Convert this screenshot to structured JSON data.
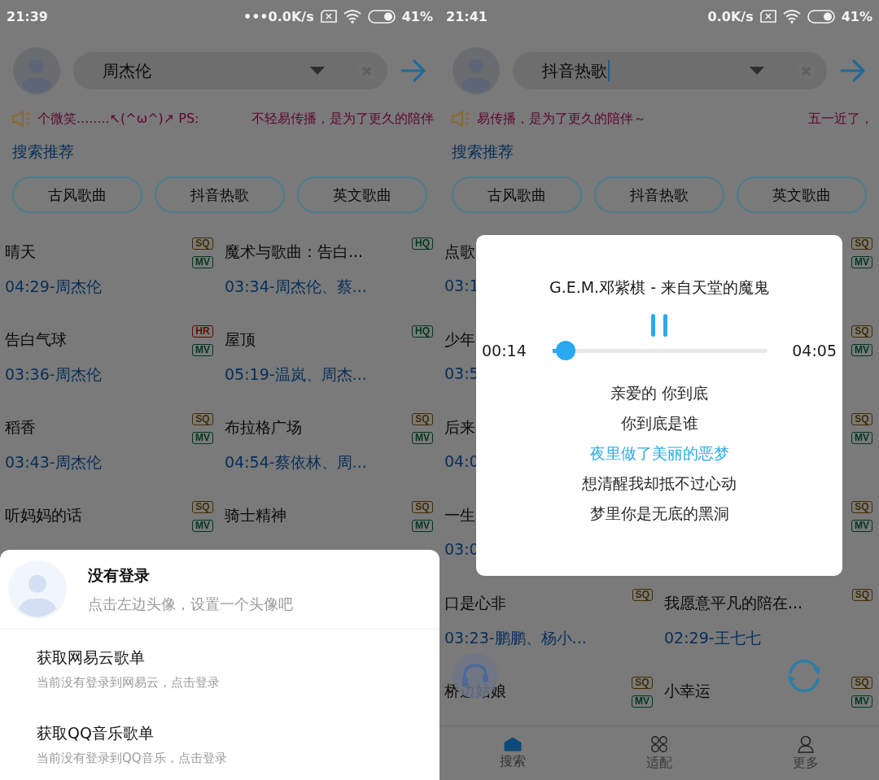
{
  "phones": [
    {
      "status": {
        "time": "21:39",
        "net_speed": "•••0.0K/s",
        "battery": "41%"
      },
      "search": {
        "value": "周杰伦",
        "caret": false
      },
      "marquee": [
        "个微笑........↖(^ω^)↗  PS:",
        "不轻易传播，是为了更久的陪伴"
      ],
      "section_title": "搜索推荐",
      "chips": [
        "古风歌曲",
        "抖音热歌",
        "英文歌曲"
      ],
      "songs": [
        {
          "title": "晴天",
          "info": "04:29-周杰伦",
          "badges": [
            {
              "label": "SQ",
              "color": "#422c00"
            },
            {
              "label": "MV",
              "color": "#00361f"
            }
          ]
        },
        {
          "title": "魔术与歌曲：告白...",
          "info": "03:34-周杰伦、蔡...",
          "badges": [
            {
              "label": "HQ",
              "color": "#00361f"
            }
          ]
        },
        {
          "title": "告白气球",
          "info": "03:36-周杰伦",
          "badges": [
            {
              "label": "HR",
              "color": "#5c0a00"
            },
            {
              "label": "MV",
              "color": "#00361f"
            }
          ]
        },
        {
          "title": "屋顶",
          "info": "05:19-温岚、周杰...",
          "badges": [
            {
              "label": "HQ",
              "color": "#00361f"
            }
          ]
        },
        {
          "title": "稻香",
          "info": "03:43-周杰伦",
          "badges": [
            {
              "label": "SQ",
              "color": "#422c00"
            },
            {
              "label": "MV",
              "color": "#00361f"
            }
          ]
        },
        {
          "title": "布拉格广场",
          "info": "04:54-蔡依林、周...",
          "badges": [
            {
              "label": "SQ",
              "color": "#422c00"
            },
            {
              "label": "MV",
              "color": "#00361f"
            }
          ]
        },
        {
          "title": "听妈妈的话",
          "badges": [
            {
              "label": "SQ",
              "color": "#422c00"
            },
            {
              "label": "MV",
              "color": "#00361f"
            }
          ]
        },
        {
          "title": "骑士精神",
          "badges": [
            {
              "label": "SQ",
              "color": "#422c00"
            },
            {
              "label": "MV",
              "color": "#00361f"
            }
          ]
        }
      ],
      "sheet": {
        "title": "没有登录",
        "subtitle": "点击左边头像，设置一个头像吧",
        "items": [
          {
            "title": "获取网易云歌单",
            "subtitle": "当前没有登录到网易云，点击登录"
          },
          {
            "title": "获取QQ音乐歌单",
            "subtitle": "当前没有登录到QQ音乐，点击登录"
          }
        ]
      }
    },
    {
      "status": {
        "time": "21:41",
        "net_speed": "0.0K/s",
        "battery": "41%"
      },
      "search": {
        "value": "抖音热歌",
        "caret": true
      },
      "marquee": [
        "易传播，是为了更久的陪伴～",
        "五一近了，"
      ],
      "section_title": "搜索推荐",
      "chips": [
        "古风歌曲",
        "抖音热歌",
        "英文歌曲"
      ],
      "songs": [
        {
          "title": "点歌",
          "info": "03:1"
        },
        {
          "badges": [
            {
              "label": "SQ",
              "color": "#422c00"
            },
            {
              "label": "MV",
              "color": "#00361f"
            }
          ]
        },
        {
          "title": "少年",
          "info": "03:5"
        },
        {
          "badges": [
            {
              "label": "SQ",
              "color": "#422c00"
            },
            {
              "label": "MV",
              "color": "#00361f"
            }
          ]
        },
        {
          "title": "后来",
          "info": "04:0"
        },
        {
          "badges": [
            {
              "label": "SQ",
              "color": "#422c00"
            },
            {
              "label": "MV",
              "color": "#00361f"
            }
          ]
        },
        {
          "title": "一生",
          "info": "03:0"
        },
        {
          "badges": [
            {
              "label": "SQ",
              "color": "#422c00"
            },
            {
              "label": "MV",
              "color": "#00361f"
            }
          ]
        },
        {
          "title": "口是心非",
          "info": "03:23-鹏鹏、杨小...",
          "badges": [
            {
              "label": "SQ",
              "color": "#422c00"
            }
          ]
        },
        {
          "title": "我愿意平凡的陪在...",
          "info": "02:29-王七七",
          "badges": [
            {
              "label": "SQ",
              "color": "#422c00"
            }
          ]
        },
        {
          "title": "桥边姑娘",
          "badges": [
            {
              "label": "SQ",
              "color": "#422c00"
            },
            {
              "label": "MV",
              "color": "#00361f"
            }
          ]
        },
        {
          "title": "小幸运",
          "badges": [
            {
              "label": "SQ",
              "color": "#422c00"
            },
            {
              "label": "MV",
              "color": "#00361f"
            }
          ]
        }
      ],
      "player": {
        "title": "G.E.M.邓紫棋 - 来自天堂的魔鬼",
        "elapsed": "00:14",
        "duration": "04:05",
        "level": 0.06,
        "lyrics": [
          {
            "text": "亲爱的 你到底",
            "current": false
          },
          {
            "text": "你到底是谁",
            "current": false
          },
          {
            "text": "夜里做了美丽的恶梦",
            "current": true
          },
          {
            "text": "想清醒我却抵不过心动",
            "current": false
          },
          {
            "text": "梦里你是无底的黑洞",
            "current": false
          }
        ]
      },
      "floating_buttons": true,
      "nav": [
        {
          "label": "搜索",
          "selected": true
        },
        {
          "label": "适配",
          "selected": false
        },
        {
          "label": "更多",
          "selected": false
        }
      ]
    }
  ]
}
